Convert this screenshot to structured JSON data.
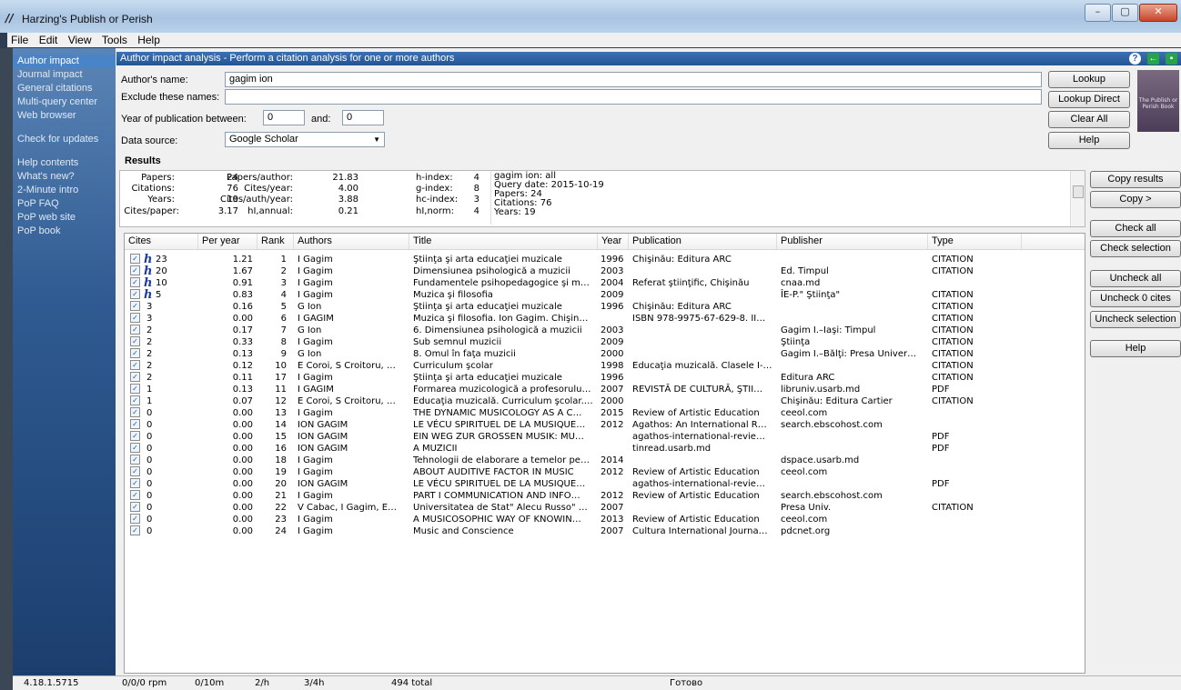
{
  "window": {
    "title": "Harzing's Publish or Perish"
  },
  "menu": [
    "File",
    "Edit",
    "View",
    "Tools",
    "Help"
  ],
  "nav": {
    "group1": [
      "Author impact",
      "Journal impact",
      "General citations",
      "Multi-query center",
      "Web browser"
    ],
    "group2": [
      "Check for updates"
    ],
    "group3": [
      "Help contents",
      "What's new?",
      "2-Minute intro",
      "PoP FAQ",
      "PoP web site",
      "PoP book"
    ]
  },
  "header": {
    "title": "Author impact analysis - Perform a citation analysis for one or more authors"
  },
  "form": {
    "author_label": "Author's name:",
    "author_value": "gagim ion",
    "exclude_label": "Exclude these names:",
    "exclude_value": "",
    "year_label": "Year of publication between:",
    "year_from": "0",
    "and_label": "and:",
    "year_to": "0",
    "source_label": "Data source:",
    "source_value": "Google Scholar"
  },
  "buttons": {
    "lookup": "Lookup",
    "lookup_direct": "Lookup Direct",
    "clear_all": "Clear All",
    "help": "Help"
  },
  "results": {
    "title": "Results",
    "papers_label": "Papers:",
    "papers": "24",
    "citations_label": "Citations:",
    "citations": "76",
    "years_label": "Years:",
    "years": "19",
    "cites_paper_label": "Cites/paper:",
    "cites_paper": "3.17",
    "papers_author_label": "Papers/author:",
    "papers_author": "21.83",
    "cites_year_label": "Cites/year:",
    "cites_year": "4.00",
    "cites_auth_year_label": "Cites/auth/year:",
    "cites_auth_year": "3.88",
    "hi_annual_label": "hI,annual:",
    "hi_annual": "0.21",
    "h_index_label": "h-index:",
    "h_index": "4",
    "g_index_label": "g-index:",
    "g_index": "8",
    "hc_index_label": "hc-index:",
    "hc_index": "3",
    "hi_norm_label": "hI,norm:",
    "hi_norm": "4",
    "summary": "gagim ion: all\nQuery date: 2015-10-19\nPapers: 24\nCitations: 76\nYears: 19"
  },
  "table": {
    "columns": [
      "Cites",
      "Per year",
      "Rank",
      "Authors",
      "Title",
      "Year",
      "Publication",
      "Publisher",
      "Type"
    ],
    "rows": [
      {
        "cites": "23",
        "h": true,
        "per_year": "1.21",
        "rank": "1",
        "authors": "I Gagim",
        "title": "Ştiinţa şi arta educaţiei muzicale",
        "year": "1996",
        "publication": "Chişinău: Editura ARC",
        "publisher": "",
        "type": "CITATION"
      },
      {
        "cites": "20",
        "h": true,
        "per_year": "1.67",
        "rank": "2",
        "authors": "I Gagim",
        "title": "Dimensiunea psihologică a muzicii",
        "year": "2003",
        "publication": "",
        "publisher": "Ed. Timpul",
        "type": "CITATION"
      },
      {
        "cites": "10",
        "h": true,
        "per_year": "0.91",
        "rank": "3",
        "authors": "I Gagim",
        "title": "Fundamentele psihopedagogice şi m…",
        "year": "2004",
        "publication": "Referat ştiinţific, Chişinău",
        "publisher": "cnaa.md",
        "type": ""
      },
      {
        "cites": "5",
        "h": true,
        "per_year": "0.83",
        "rank": "4",
        "authors": "I Gagim",
        "title": "Muzica şi filosofia",
        "year": "2009",
        "publication": "",
        "publisher": "ÎE-P.\" Ştiinţa\"",
        "type": "CITATION"
      },
      {
        "cites": "3",
        "h": false,
        "per_year": "0.16",
        "rank": "5",
        "authors": "G Ion",
        "title": "Ştiinţa şi arta educaţiei muzicale",
        "year": "1996",
        "publication": "Chişinău: Editura ARC",
        "publisher": "",
        "type": "CITATION"
      },
      {
        "cites": "3",
        "h": false,
        "per_year": "0.00",
        "rank": "6",
        "authors": "I GAGIM",
        "title": "Muzica şi filosofia. Ion Gagim. Chişin…",
        "year": "",
        "publication": "ISBN 978-9975-67-629-8. II…",
        "publisher": "",
        "type": "CITATION"
      },
      {
        "cites": "2",
        "h": false,
        "per_year": "0.17",
        "rank": "7",
        "authors": "G Ion",
        "title": "6. Dimensiunea psihologică a muzicii",
        "year": "2003",
        "publication": "",
        "publisher": "Gagim I.–Iaşi: Timpul",
        "type": "CITATION"
      },
      {
        "cites": "2",
        "h": false,
        "per_year": "0.33",
        "rank": "8",
        "authors": "I Gagim",
        "title": "Sub semnul muzicii",
        "year": "2009",
        "publication": "",
        "publisher": "Ştiinţa",
        "type": "CITATION"
      },
      {
        "cites": "2",
        "h": false,
        "per_year": "0.13",
        "rank": "9",
        "authors": "G Ion",
        "title": "8. Omul în faţa muzicii",
        "year": "2000",
        "publication": "",
        "publisher": "Gagim I.–Bălţi: Presa Univer…",
        "type": "CITATION"
      },
      {
        "cites": "2",
        "h": false,
        "per_year": "0.12",
        "rank": "10",
        "authors": "E Coroi, S Croitoru, …",
        "title": "Curriculum şcolar",
        "year": "1998",
        "publication": "Educaţia muzicală. Clasele I-…",
        "publisher": "",
        "type": "CITATION"
      },
      {
        "cites": "2",
        "h": false,
        "per_year": "0.11",
        "rank": "17",
        "authors": "I Gagim",
        "title": "Ştiinţa şi arta educaţiei muzicale",
        "year": "1996",
        "publication": "",
        "publisher": "Editura ARC",
        "type": "CITATION"
      },
      {
        "cites": "1",
        "h": false,
        "per_year": "0.13",
        "rank": "11",
        "authors": "I GAGIM",
        "title": "Formarea muzicologică a profesorulu…",
        "year": "2007",
        "publication": "REVISTĂ DE CULTURĂ, ŞTII…",
        "publisher": "libruniv.usarb.md",
        "type": "PDF"
      },
      {
        "cites": "1",
        "h": false,
        "per_year": "0.07",
        "rank": "12",
        "authors": "E Coroi, S Croitoru, …",
        "title": "Educaţia muzicală. Curriculum şcolar.…",
        "year": "2000",
        "publication": "",
        "publisher": "Chişinău: Editura Cartier",
        "type": "CITATION"
      },
      {
        "cites": "0",
        "h": false,
        "per_year": "0.00",
        "rank": "13",
        "authors": "I Gagim",
        "title": "THE DYNAMIC MUSICOLOGY AS A C…",
        "year": "2015",
        "publication": "Review of Artistic Education",
        "publisher": "ceeol.com",
        "type": ""
      },
      {
        "cites": "0",
        "h": false,
        "per_year": "0.00",
        "rank": "14",
        "authors": "ION GAGIM",
        "title": "LE VÉCU SPIRITUEL DE LA MUSIQUE…",
        "year": "2012",
        "publication": "Agathos: An International R…",
        "publisher": "search.ebscohost.com",
        "type": ""
      },
      {
        "cites": "0",
        "h": false,
        "per_year": "0.00",
        "rank": "15",
        "authors": "ION GAGIM",
        "title": "EIN WEG ZUR GROSSEN MUSIK: MU…",
        "year": "",
        "publication": "agathos-international-revie…",
        "publisher": "",
        "type": "PDF"
      },
      {
        "cites": "0",
        "h": false,
        "per_year": "0.00",
        "rank": "16",
        "authors": "ION GAGIM",
        "title": "A MUZICII",
        "year": "",
        "publication": "tinread.usarb.md",
        "publisher": "",
        "type": "PDF"
      },
      {
        "cites": "0",
        "h": false,
        "per_year": "0.00",
        "rank": "18",
        "authors": "I Gagim",
        "title": "Tehnologii de elaborare a temelor pe…",
        "year": "2014",
        "publication": "",
        "publisher": "dspace.usarb.md",
        "type": ""
      },
      {
        "cites": "0",
        "h": false,
        "per_year": "0.00",
        "rank": "19",
        "authors": "I Gagim",
        "title": "ABOUT AUDITIVE FACTOR IN MUSIC",
        "year": "2012",
        "publication": "Review of Artistic Education",
        "publisher": "ceeol.com",
        "type": ""
      },
      {
        "cites": "0",
        "h": false,
        "per_year": "0.00",
        "rank": "20",
        "authors": "ION GAGIM",
        "title": "LE VÉCU SPIRITUEL DE LA MUSIQUE…",
        "year": "",
        "publication": "agathos-international-revie…",
        "publisher": "",
        "type": "PDF"
      },
      {
        "cites": "0",
        "h": false,
        "per_year": "0.00",
        "rank": "21",
        "authors": "I Gagim",
        "title": "PART I COMMUNICATION AND INFO…",
        "year": "2012",
        "publication": "Review of Artistic Education",
        "publisher": "search.ebscohost.com",
        "type": ""
      },
      {
        "cites": "0",
        "h": false,
        "per_year": "0.00",
        "rank": "22",
        "authors": "V Cabac, I Gagim, E…",
        "title": "Universitatea de Stat\" Alecu Russo\" …",
        "year": "2007",
        "publication": "",
        "publisher": "Presa Univ.",
        "type": "CITATION"
      },
      {
        "cites": "0",
        "h": false,
        "per_year": "0.00",
        "rank": "23",
        "authors": "I Gagim",
        "title": "A MUSICOSOPHIC WAY OF KNOWIN…",
        "year": "2013",
        "publication": "Review of Artistic Education",
        "publisher": "ceeol.com",
        "type": ""
      },
      {
        "cites": "0",
        "h": false,
        "per_year": "0.00",
        "rank": "24",
        "authors": "I Gagim",
        "title": "Music and Conscience",
        "year": "2007",
        "publication": "Cultura International Journa…",
        "publisher": "pdcnet.org",
        "type": ""
      }
    ]
  },
  "side_buttons": [
    "Copy results",
    "Copy >",
    "Check all",
    "Check selection",
    "Uncheck all",
    "Uncheck 0 cites",
    "Uncheck selection",
    "Help"
  ],
  "status": {
    "version": "4.18.1.5715",
    "rpm": "0/0/0 rpm",
    "per10m": "0/10m",
    "per_h": "2/h",
    "per4h": "3/4h",
    "total": "494 total",
    "state": "Готово"
  },
  "icons": {
    "help": "question-icon",
    "back": "green-arrow-icon",
    "book": "pop-book-cover"
  }
}
